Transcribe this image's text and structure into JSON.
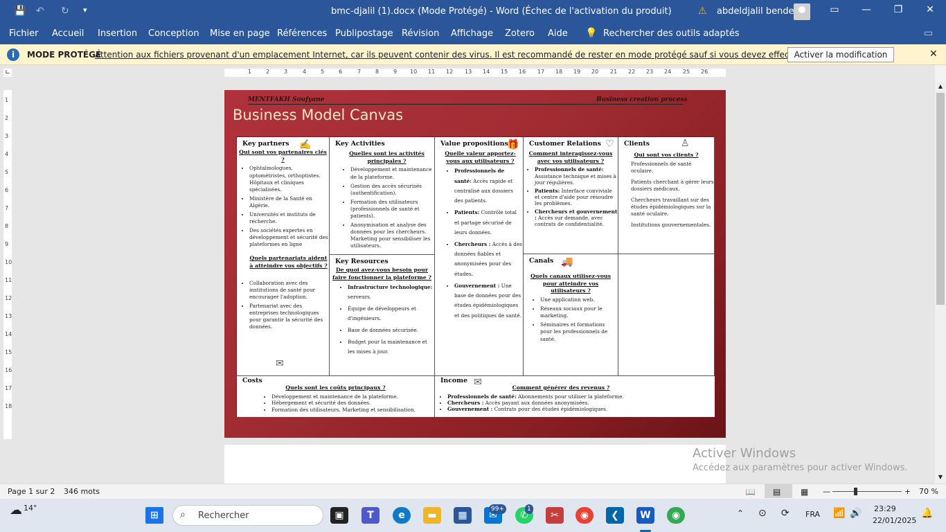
{
  "titlebar": {
    "title": "bmc-djalil (1).docx (Mode Protégé)  -  Word (Échec de l'activation du produit)",
    "user": "abdeldjalil bendella",
    "save_icon": "save-icon",
    "undo_icon": "undo-icon",
    "redo_icon": "redo-icon",
    "customize_icon": "chevron-down-icon",
    "warning_icon": "warning-icon",
    "minimize": "—",
    "restore": "❐",
    "close": "✕",
    "ribbon_display": "▭"
  },
  "menu": {
    "items": [
      "Fichier",
      "Accueil",
      "Insertion",
      "Conception",
      "Mise en page",
      "Références",
      "Publipostage",
      "Révision",
      "Affichage",
      "Zotero",
      "Aide"
    ],
    "search_label": "Rechercher des outils adaptés",
    "comments_icon": "comment-icon"
  },
  "protected_bar": {
    "label": "MODE PROTÉGÉ",
    "message": "Attention aux fichiers provenant d'un emplacement Internet, car ils peuvent contenir des virus. Il est recommandé de rester en mode protégé sauf si vous devez effectuer des modifications.",
    "button": "Activer la modification",
    "close": "✕"
  },
  "document": {
    "header_left": "MENTFAKH Soufyane",
    "header_right": "Business creation process",
    "title": "Business Model Canvas",
    "key_partners": {
      "heading": "Key partners",
      "q1": "Qui sont vos partenaires clés ?",
      "items1": [
        "Ophtalmologues, optométristes, orthoptistes. Hôpitaux et cliniques spécialisées.",
        "Ministère de la Santé en Algérie.",
        "Universités et instituts de recherche.",
        "Des sociétés expertes en développement et sécurité des plateformes en ligne"
      ],
      "q2": "Quels partenariats aident à atteindre vos objectifs ?",
      "items2": [
        "Collaboration avec des institutions de santé pour encourager l'adoption.",
        "Partenariat avec des entreprises technologiques pour garantir la sécurité des données."
      ]
    },
    "key_activities": {
      "heading": "Key Activities",
      "q1": "Quelles sont les activités principales ?",
      "items": [
        "Développement et maintenance de la plateforme.",
        "Gestion des accès sécurisés (authentification).",
        "Formation des utilisateurs (professionnels de santé et patients).",
        "Anonymisation et analyse des données pour les chercheurs. Marketing pour sensibiliser les utilisateurs."
      ]
    },
    "key_resources": {
      "heading": "Key Resources",
      "q1": "De quoi avez-vous besoin pour faire fonctionner la plateforme ?",
      "i1_b": "Infrastructure technologique:",
      "i1_t": " serveurs.",
      "items": [
        "Équipe de développeurs et d'ingénieurs.",
        "Base de données sécurisée.",
        "Budget pour la maintenance et les mises à jour."
      ]
    },
    "value_props": {
      "heading": "Value propositions",
      "q1": "Quelle valeur apportez-vous aux utilisateurs ?",
      "i1_b": "Professionnels de santé:",
      "i1_t": " Accès rapide et centralisé aux dossiers des patients.",
      "i2_b": "Patients:",
      "i2_t": " Contrôle total et partage sécurisé de leurs données.",
      "i3_b": "Chercheurs :",
      "i3_t": " Accès à des données fiables et anonymisées pour des études.",
      "i4_b": "Gouvernement :",
      "i4_t": " Une base de données pour des études épidémiologiques et des politiques de santé."
    },
    "customer_relations": {
      "heading": "Customer Relations",
      "q1": "Comment interagissez-vous avec vos utilisateurs ?",
      "i1_b": "Professionnels de santé:",
      "i1_t": " Assistance technique et mises à jour régulières.",
      "i2_b": "Patients:",
      "i2_t": " Interface conviviale et centre d'aide pour résoudre les problèmes.",
      "i3_b": "Chercheurs et gouvernement :",
      "i3_t": " Accès sur demande, avec contrats de confidentialité."
    },
    "channels": {
      "heading": "Canals",
      "q1": "Quels canaux utilisez-vous pour atteindre vos utilisateurs ?",
      "items": [
        "Une application web.",
        "Réseaux sociaux pour le marketing.",
        "Séminaires et formations pour les professionnels de santé."
      ]
    },
    "clients": {
      "heading": "Clients",
      "q1": "Qui sont vos clients ?",
      "items": [
        "Professionnels de santé oculaire.",
        "Patients cherchant à gérer leurs dossiers médicaux.",
        "Chercheurs travaillant sur des études épidémiologiques sur la santé oculaire.",
        "Institutions gouvernementales."
      ]
    },
    "costs": {
      "heading": "Costs",
      "q1": "Quels sont les coûts principaux ?",
      "items": [
        "Développement et maintenance de la plateforme.",
        "Hébergement et sécurité des données.",
        "Formation des utilisateurs. Marketing et sensibilisation."
      ]
    },
    "income": {
      "heading": "Income",
      "q1": "Comment générer des revenus ?",
      "i1_b": "Professionnels de santé:",
      "i1_t": " Abonnements pour utiliser la plateforme.",
      "i2_b": "Chercheurs :",
      "i2_t": " Accès payant aux données anonymisées.",
      "i3_b": "Gouvernement :",
      "i3_t": " Contrats pour des études épidémiologiques."
    }
  },
  "watermark": {
    "line1": "Activer Windows",
    "line2": "Accédez aux paramètres pour activer Windows."
  },
  "status": {
    "page": "Page 1 sur 2",
    "words": "346 mots",
    "zoom_minus": "—",
    "zoom_plus": "+",
    "zoom": "70 %"
  },
  "taskbar": {
    "weather": "14°",
    "search_placeholder": "Rechercher",
    "mail_badge": "99+",
    "whatsapp_badge": "1",
    "lang": "FRA",
    "time": "23:29",
    "date": "22/01/2025"
  }
}
